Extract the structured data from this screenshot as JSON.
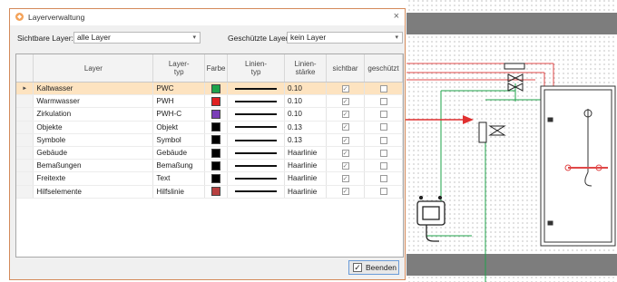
{
  "dialog": {
    "title": "Layerverwaltung",
    "close_glyph": "×",
    "visible_layer_label": "Sichtbare Layer:",
    "visible_layer_value": "alle Layer",
    "protected_layer_label": "Geschützte Layer:",
    "protected_layer_value": "kein Layer",
    "end_button": "Beenden"
  },
  "grid": {
    "headers": {
      "layer": "Layer",
      "layer_type_1": "Layer-",
      "layer_type_2": "typ",
      "color": "Farbe",
      "line_type_1": "Linien-",
      "line_type_2": "typ",
      "line_width_1": "Linien-",
      "line_width_2": "stärke",
      "visible": "sichtbar",
      "protected": "geschützt"
    },
    "rows": [
      {
        "name": "Kaltwasser",
        "type": "PWC",
        "color": "#1ea34a",
        "width": "0.10",
        "visible": true,
        "protected": false,
        "selected": true
      },
      {
        "name": "Warmwasser",
        "type": "PWH",
        "color": "#e02020",
        "width": "0.10",
        "visible": true,
        "protected": false,
        "selected": false
      },
      {
        "name": "Zirkulation",
        "type": "PWH-C",
        "color": "#7b3fb8",
        "width": "0.10",
        "visible": true,
        "protected": false,
        "selected": false
      },
      {
        "name": "Objekte",
        "type": "Objekt",
        "color": "#000000",
        "width": "0.13",
        "visible": true,
        "protected": false,
        "selected": false
      },
      {
        "name": "Symbole",
        "type": "Symbol",
        "color": "#000000",
        "width": "0.13",
        "visible": true,
        "protected": false,
        "selected": false
      },
      {
        "name": "Gebäude",
        "type": "Gebäude",
        "color": "#000000",
        "width": "Haarlinie",
        "visible": true,
        "protected": false,
        "selected": false
      },
      {
        "name": "Bemaßungen",
        "type": "Bemaßung",
        "color": "#000000",
        "width": "Haarlinie",
        "visible": true,
        "protected": false,
        "selected": false
      },
      {
        "name": "Freitexte",
        "type": "Text",
        "color": "#000000",
        "width": "Haarlinie",
        "visible": true,
        "protected": false,
        "selected": false
      },
      {
        "name": "Hilfselemente",
        "type": "Hilfslinie",
        "color": "#b84040",
        "width": "Haarlinie",
        "visible": true,
        "protected": false,
        "selected": false
      }
    ]
  },
  "colors": {
    "accent_border": "#d48a5a",
    "selected_row": "#fde3c0",
    "annotation_arrow": "#e03030"
  }
}
